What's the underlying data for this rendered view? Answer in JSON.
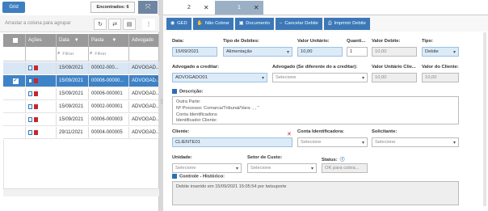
{
  "left": {
    "grid_tab": "Grid",
    "found_label": "Encontrados: 6",
    "drag_hint": "Arrastar a coluna para agrupar",
    "columns": [
      "",
      "Ações",
      "Data",
      "Pasta",
      "Advogado"
    ],
    "filter_placeholder": "Filtrar",
    "rows": [
      {
        "date": "15/09/2021",
        "pasta": "00002-000...",
        "adv": "ADVOGAD..."
      },
      {
        "date": "15/09/2021",
        "pasta": "00006-00000...",
        "adv": "ADVOGAD..."
      },
      {
        "date": "15/09/2021",
        "pasta": "00006-000001",
        "adv": "ADVOGAD..."
      },
      {
        "date": "15/09/2021",
        "pasta": "00002-000001",
        "adv": "ADVOGAD..."
      },
      {
        "date": "15/09/2021",
        "pasta": "00006-000003",
        "adv": "ADVOGAD..."
      },
      {
        "date": "29/11/2021",
        "pasta": "00004-000005",
        "adv": "ADVOGAD..."
      }
    ]
  },
  "tabs": [
    {
      "label": "2",
      "close": "✕"
    },
    {
      "label": "1",
      "close": "✕"
    }
  ],
  "toolbar": {
    "ged": "GED",
    "nao_cobrar": "Não Cobrar",
    "documento": "Documento",
    "cancelar": "Cancelar Debite",
    "imprimir": "Imprimir Debite"
  },
  "form": {
    "data_label": "Data:",
    "data_value": "15/09/2021",
    "tipo_debites_label": "Tipo de Debites:",
    "tipo_debites_value": "Alimentação",
    "valor_unitario_label": "Valor Unitário:",
    "valor_unitario_value": "10,00",
    "quantidade_label": "Quanti...",
    "quantidade_value": "1",
    "valor_debite_label": "Valor Debite:",
    "valor_debite_value": "10,00",
    "tipo_label": "Tipo:",
    "tipo_value": "Debite",
    "advogado_label": "Advogado a creditar:",
    "advogado_value": "ADVOGADO01",
    "advogado2_label": "Advogado (Se diferente do a creditar):",
    "advogado2_placeholder": "Selecione",
    "valor_unit_cli_label": "Valor Unitário Clie...",
    "valor_unit_cli_value": "10,00",
    "valor_cliente_label": "Valor do Cliente:",
    "valor_cliente_value": "10,00",
    "descricao_label": "Descrição:",
    "descricao_lines": [
      "Outra Parte:",
      "Nº Processo:                    Comarca/Tribunal/Vara: , , \"",
      "Conta Identificadora:",
      "Identificador Cliente:"
    ],
    "cliente_label": "Cliente:",
    "cliente_value": "CLIENTE01",
    "cliente_clear": "✕",
    "conta_label": "Conta Identificadora:",
    "conta_placeholder": "Selecione",
    "solicitante_label": "Solicitante:",
    "solicitante_placeholder": "Selecione",
    "unidade_label": "Unidade:",
    "unidade_placeholder": "Selecione",
    "setor_label": "Setor de Custo:",
    "setor_placeholder": "Selecione",
    "status_label": "Status:",
    "status_value": "OK para cobra...",
    "controle_label": "Controle - Histórico:",
    "controle_text": "Debite inserido em 15/09/2021 15:05:54 por twtsuporte"
  }
}
